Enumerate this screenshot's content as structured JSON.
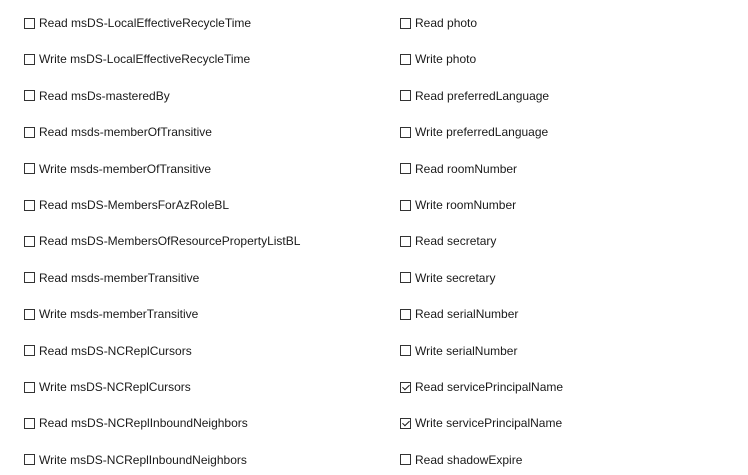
{
  "permissions": {
    "left": [
      {
        "label": "Read msDS-LocalEffectiveRecycleTime",
        "checked": false
      },
      {
        "label": "Write msDS-LocalEffectiveRecycleTime",
        "checked": false
      },
      {
        "label": "Read msDs-masteredBy",
        "checked": false
      },
      {
        "label": "Read msds-memberOfTransitive",
        "checked": false
      },
      {
        "label": "Write msds-memberOfTransitive",
        "checked": false
      },
      {
        "label": "Read msDS-MembersForAzRoleBL",
        "checked": false
      },
      {
        "label": "Read msDS-MembersOfResourcePropertyListBL",
        "checked": false
      },
      {
        "label": "Read msds-memberTransitive",
        "checked": false
      },
      {
        "label": "Write msds-memberTransitive",
        "checked": false
      },
      {
        "label": "Read msDS-NCReplCursors",
        "checked": false
      },
      {
        "label": "Write msDS-NCReplCursors",
        "checked": false
      },
      {
        "label": "Read msDS-NCReplInboundNeighbors",
        "checked": false
      },
      {
        "label": "Write msDS-NCReplInboundNeighbors",
        "checked": false
      }
    ],
    "right": [
      {
        "label": "Read photo",
        "checked": false
      },
      {
        "label": "Write photo",
        "checked": false
      },
      {
        "label": "Read preferredLanguage",
        "checked": false
      },
      {
        "label": "Write preferredLanguage",
        "checked": false
      },
      {
        "label": "Read roomNumber",
        "checked": false
      },
      {
        "label": "Write roomNumber",
        "checked": false
      },
      {
        "label": "Read secretary",
        "checked": false
      },
      {
        "label": "Write secretary",
        "checked": false
      },
      {
        "label": "Read serialNumber",
        "checked": false
      },
      {
        "label": "Write serialNumber",
        "checked": false
      },
      {
        "label": "Read servicePrincipalName",
        "checked": true
      },
      {
        "label": "Write servicePrincipalName",
        "checked": true
      },
      {
        "label": "Read shadowExpire",
        "checked": false
      }
    ]
  }
}
